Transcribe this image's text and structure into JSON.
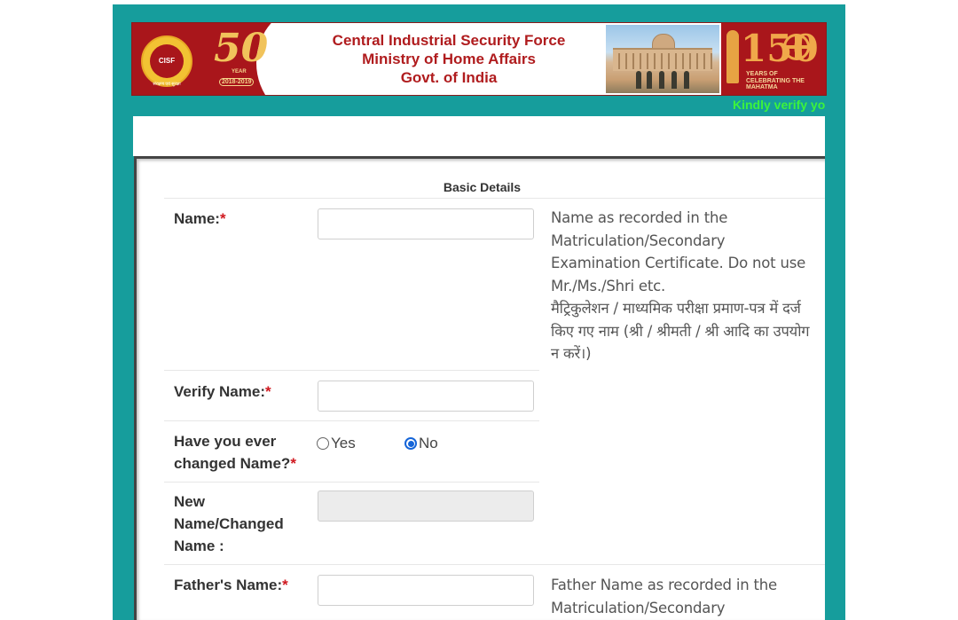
{
  "banner": {
    "emblem_label": "CISF",
    "emblem_subtext": "संरक्षण एवं सुरक्षा",
    "anniversary_number": "50",
    "anniversary_word": "YEAR",
    "anniversary_years": "2018-2019",
    "org_line1": "Central Industrial Security Force",
    "org_line2": "Ministry of Home Affairs",
    "org_line3": "Govt. of India",
    "gandhi_number": "150",
    "gandhi_text": "YEARS OF CELEBRATING THE MAHATMA"
  },
  "marquee": "Kindly verify yo",
  "form": {
    "section_title": "Basic Details",
    "name": {
      "label": "Name:",
      "required_mark": "*",
      "value": "",
      "help_en": "Name as recorded in the Matriculation/Secondary Examination Certificate. Do not use Mr./Ms./Shri etc.",
      "help_hi": "मैट्रिकुलेशन / माध्यमिक परीक्षा प्रमाण-पत्र में दर्ज किए गए नाम (श्री / श्रीमती / श्री आदि का उपयोग न करें।)"
    },
    "verify_name": {
      "label": "Verify Name:",
      "required_mark": "*",
      "value": ""
    },
    "changed_name": {
      "label_line1": "Have you ever",
      "label_line2": "changed Name?",
      "required_mark": "*",
      "options": [
        "Yes",
        "No"
      ],
      "selected": "No"
    },
    "new_name": {
      "label_line1": "New",
      "label_line2": "Name/Changed",
      "label_line3": "Name :",
      "value": "",
      "disabled": true
    },
    "fathers_name": {
      "label": "Father's Name:",
      "required_mark": "*",
      "value": "",
      "help_en": "Father Name as recorded in the Matriculation/Secondary Examination"
    }
  },
  "colors": {
    "frame_teal": "#169d9c",
    "banner_red": "#a9161b",
    "title_red": "#b01c1e",
    "required_red": "#d0181f",
    "marquee_green": "#3cf33c",
    "radio_blue": "#1565d8"
  }
}
